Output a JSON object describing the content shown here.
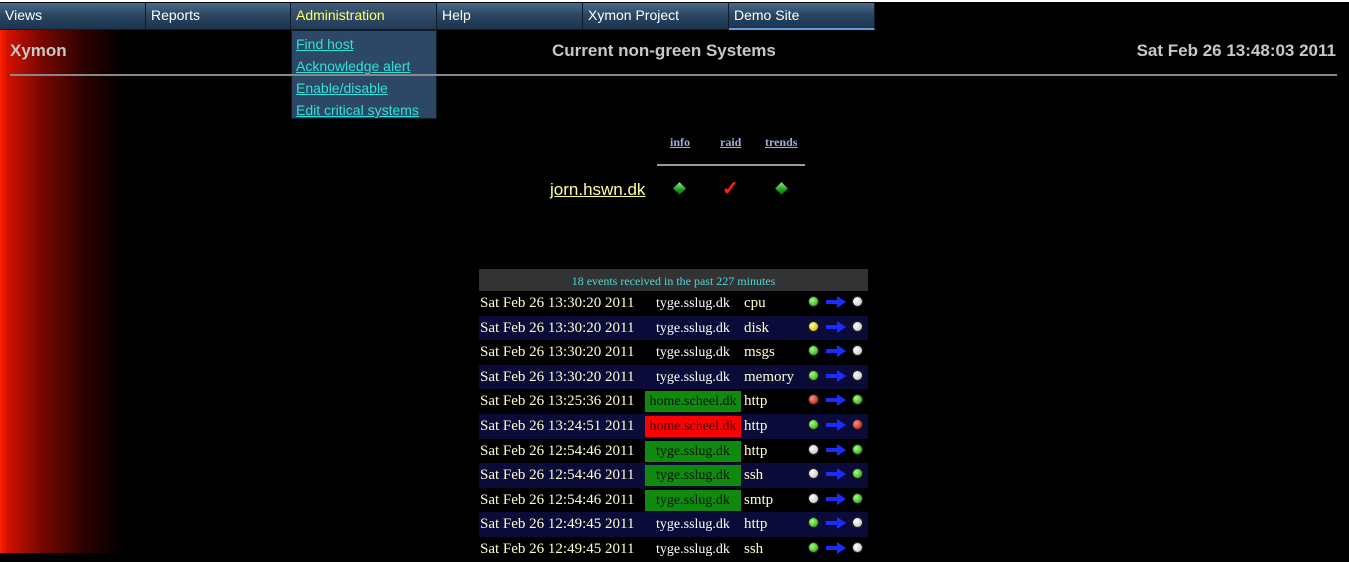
{
  "menu": {
    "items": [
      {
        "label": "Views"
      },
      {
        "label": "Reports"
      },
      {
        "label": "Administration"
      },
      {
        "label": "Help"
      },
      {
        "label": "Xymon Project"
      },
      {
        "label": "Demo Site"
      }
    ],
    "admin_dropdown": [
      "Find host",
      "Acknowledge alert",
      "Enable/disable",
      "Edit critical systems"
    ]
  },
  "header": {
    "brand": "Xymon",
    "title": "Current non-green Systems",
    "datetime": "Sat Feb 26 13:48:03 2011"
  },
  "status_table": {
    "columns": [
      "info",
      "raid",
      "trends"
    ],
    "host": "jorn.hswn.dk",
    "cells": [
      "green-diamond-icon",
      "red-check-icon",
      "green-diamond-icon"
    ]
  },
  "events": {
    "heading": "18 events received in the past 227 minutes",
    "rows": [
      {
        "time": "Sat Feb 26 13:30:20 2011",
        "host": "tyge.sslug.dk",
        "test": "cpu",
        "from": "green",
        "to": "clear"
      },
      {
        "time": "Sat Feb 26 13:30:20 2011",
        "host": "tyge.sslug.dk",
        "test": "disk",
        "from": "yellow",
        "to": "clear"
      },
      {
        "time": "Sat Feb 26 13:30:20 2011",
        "host": "tyge.sslug.dk",
        "test": "msgs",
        "from": "green",
        "to": "clear"
      },
      {
        "time": "Sat Feb 26 13:30:20 2011",
        "host": "tyge.sslug.dk",
        "test": "memory",
        "from": "green",
        "to": "clear"
      },
      {
        "time": "Sat Feb 26 13:25:36 2011",
        "host": "home.scheel.dk",
        "test": "http",
        "from": "red",
        "to": "green",
        "host_bg": "green"
      },
      {
        "time": "Sat Feb 26 13:24:51 2011",
        "host": "home.scheel.dk",
        "test": "http",
        "from": "green",
        "to": "red",
        "host_bg": "red"
      },
      {
        "time": "Sat Feb 26 12:54:46 2011",
        "host": "tyge.sslug.dk",
        "test": "http",
        "from": "clear",
        "to": "green",
        "host_bg": "green"
      },
      {
        "time": "Sat Feb 26 12:54:46 2011",
        "host": "tyge.sslug.dk",
        "test": "ssh",
        "from": "clear",
        "to": "green",
        "host_bg": "green"
      },
      {
        "time": "Sat Feb 26 12:54:46 2011",
        "host": "tyge.sslug.dk",
        "test": "smtp",
        "from": "clear",
        "to": "green",
        "host_bg": "green"
      },
      {
        "time": "Sat Feb 26 12:49:45 2011",
        "host": "tyge.sslug.dk",
        "test": "http",
        "from": "green",
        "to": "clear"
      },
      {
        "time": "Sat Feb 26 12:49:45 2011",
        "host": "tyge.sslug.dk",
        "test": "ssh",
        "from": "green",
        "to": "clear"
      }
    ]
  },
  "colors": {
    "accent": "#33e0d8",
    "menu_bg": "#2a4661",
    "green": "#0f8a0f",
    "red": "#ff0000"
  }
}
